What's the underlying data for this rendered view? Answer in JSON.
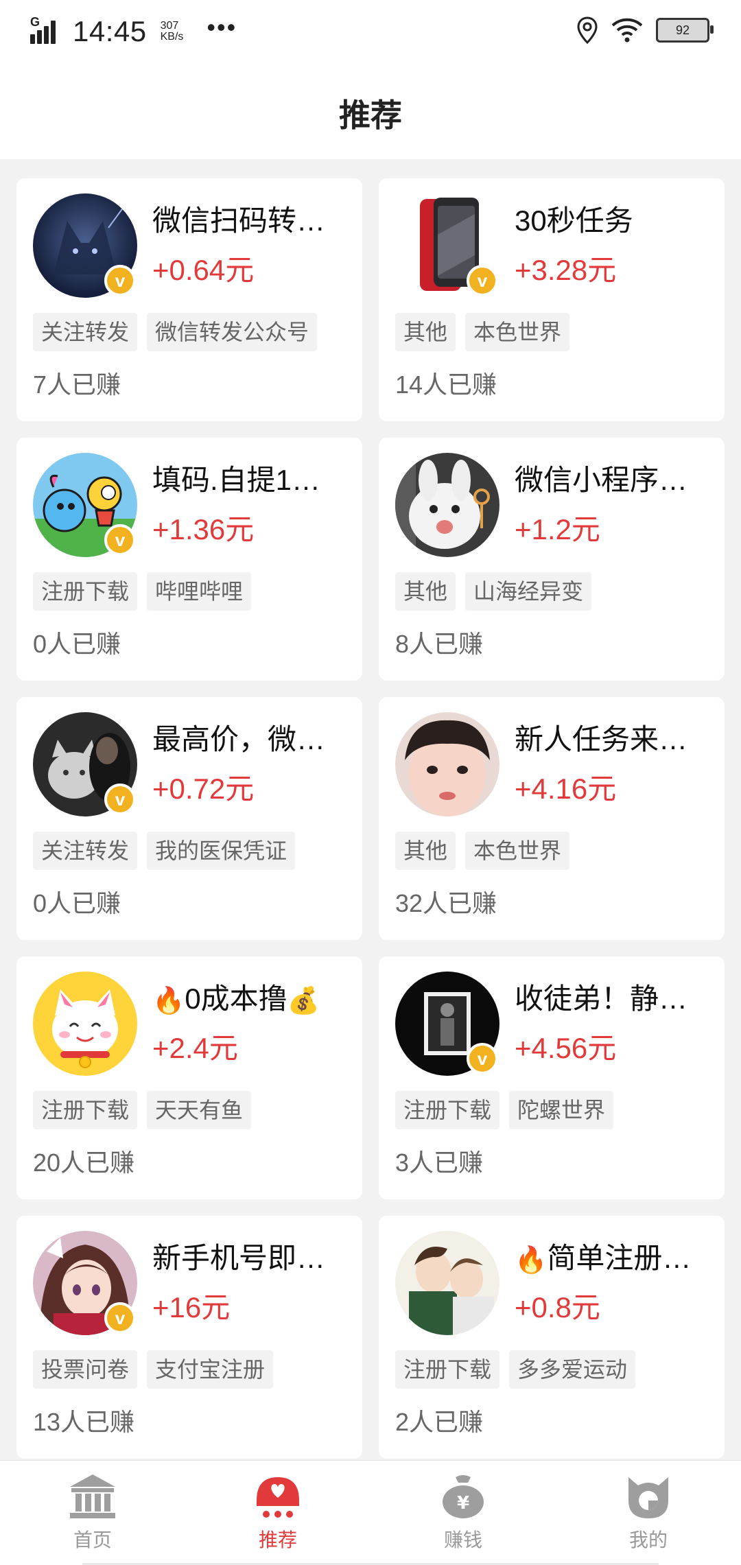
{
  "status_bar": {
    "network": "G",
    "time": "14:45",
    "speed_value": "307",
    "speed_unit": "KB/s",
    "more": "•••",
    "battery": "92"
  },
  "header": {
    "title": "推荐"
  },
  "cards": [
    {
      "title": "微信扫码转…",
      "reward": "+0.64元",
      "tags": [
        "关注转发",
        "微信转发公众号"
      ],
      "earned": "7人已赚",
      "avatar_icon": "wolf-avatar-icon",
      "verified": true
    },
    {
      "title": "30秒任务",
      "reward": "+3.28元",
      "tags": [
        "其他",
        "本色世界"
      ],
      "earned": "14人已赚",
      "avatar_icon": "phone-avatar-icon",
      "verified": true
    },
    {
      "title": "填码.自提1…",
      "reward": "+1.36元",
      "tags": [
        "注册下载",
        "哔哩哔哩"
      ],
      "earned": "0人已赚",
      "avatar_icon": "cartoon-avatar-icon",
      "verified": true
    },
    {
      "title": "微信小程序…",
      "reward": "+1.2元",
      "tags": [
        "其他",
        "山海经异变"
      ],
      "earned": "8人已赚",
      "avatar_icon": "bunny-avatar-icon",
      "verified": false
    },
    {
      "title": "最高价，微…",
      "reward": "+0.72元",
      "tags": [
        "关注转发",
        "我的医保凭证"
      ],
      "earned": "0人已赚",
      "avatar_icon": "cat-avatar-icon",
      "verified": true
    },
    {
      "title": "新人任务来…",
      "reward": "+4.16元",
      "tags": [
        "其他",
        "本色世界"
      ],
      "earned": "32人已赚",
      "avatar_icon": "child-avatar-icon",
      "verified": false
    },
    {
      "title": "0成本撸",
      "prefix_emoji": "🔥",
      "suffix_emoji": "💰",
      "reward": "+2.4元",
      "tags": [
        "注册下载",
        "天天有鱼"
      ],
      "earned": "20人已赚",
      "avatar_icon": "lucky-cat-avatar-icon",
      "verified": false
    },
    {
      "title": "收徒弟！静…",
      "reward": "+4.56元",
      "tags": [
        "注册下载",
        "陀螺世界"
      ],
      "earned": "3人已赚",
      "avatar_icon": "person-avatar-icon",
      "verified": true
    },
    {
      "title": "新手机号即…",
      "reward": "+16元",
      "tags": [
        "投票问卷",
        "支付宝注册"
      ],
      "earned": "13人已赚",
      "avatar_icon": "anime-girl-avatar-icon",
      "verified": true
    },
    {
      "title": "简单注册…",
      "prefix_emoji": "🔥",
      "reward": "+0.8元",
      "tags": [
        "注册下载",
        "多多爱运动"
      ],
      "earned": "2人已赚",
      "avatar_icon": "couple-avatar-icon",
      "verified": false
    }
  ],
  "tabbar": {
    "tabs": [
      {
        "label": "首页",
        "icon": "home-icon",
        "active": false
      },
      {
        "label": "推荐",
        "icon": "recommend-icon",
        "active": true
      },
      {
        "label": "赚钱",
        "icon": "money-bag-icon",
        "active": false
      },
      {
        "label": "我的",
        "icon": "profile-icon",
        "active": false
      }
    ]
  },
  "colors": {
    "accent": "#e23a3a",
    "verified": "#f2b21f",
    "background": "#f2f2f2",
    "card": "#ffffff",
    "muted_text": "#666666",
    "inactive_tab": "#999999"
  }
}
